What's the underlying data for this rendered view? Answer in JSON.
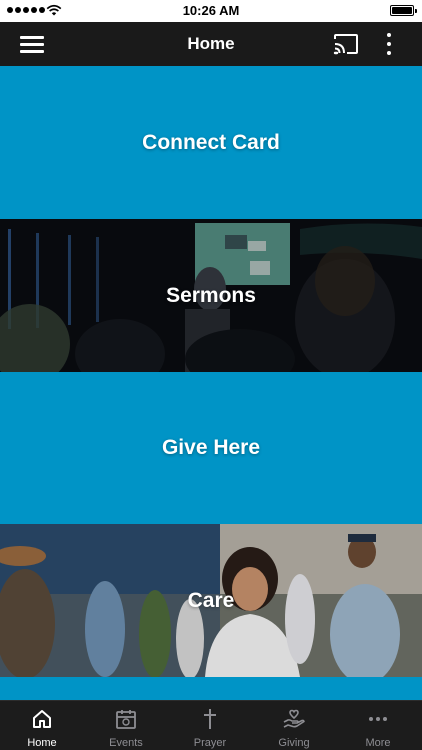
{
  "status_bar": {
    "time": "10:26 AM",
    "signal_bars": 5
  },
  "header": {
    "title": "Home",
    "icons": [
      "menu-icon",
      "cast-icon",
      "more-vertical-icon"
    ]
  },
  "tiles": [
    {
      "label": "Connect Card",
      "style": "solid",
      "color": "#0094c6"
    },
    {
      "label": "Sermons",
      "style": "photo"
    },
    {
      "label": "Give Here",
      "style": "solid",
      "color": "#0094c6"
    },
    {
      "label": "Care",
      "style": "photo"
    }
  ],
  "tab_bar": {
    "active": "Home",
    "tabs": [
      {
        "label": "Home",
        "icon": "home-icon"
      },
      {
        "label": "Events",
        "icon": "calendar-icon"
      },
      {
        "label": "Prayer",
        "icon": "cross-icon"
      },
      {
        "label": "Giving",
        "icon": "giving-hand-icon"
      },
      {
        "label": "More",
        "icon": "more-horizontal-icon"
      }
    ]
  },
  "colors": {
    "accent": "#0094c6",
    "header_bg": "#1a1a1a",
    "tabbar_bg": "#1c1c1c",
    "tab_inactive": "#8e8e93",
    "tab_active": "#ffffff"
  }
}
